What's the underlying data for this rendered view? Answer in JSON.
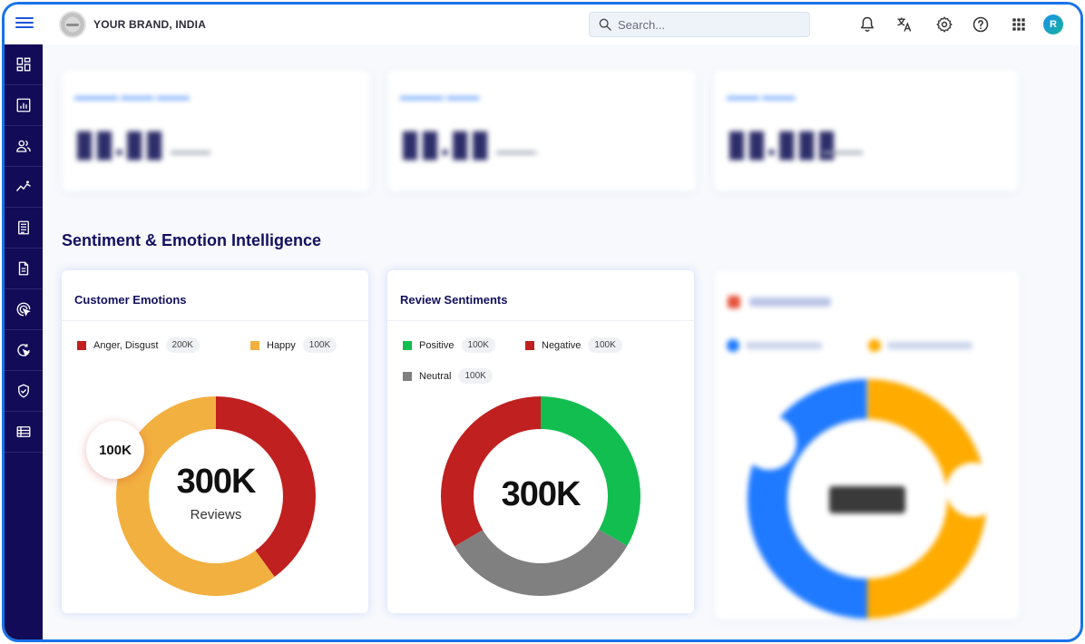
{
  "brand": {
    "name": "YOUR BRAND, INDIA"
  },
  "search": {
    "placeholder": "Search..."
  },
  "user": {
    "initial": "R"
  },
  "section": {
    "title": "Sentiment & Emotion Intelligence"
  },
  "customer_emotions": {
    "title": "Customer Emotions",
    "legend": [
      {
        "label": "Anger, Disgust",
        "count": "200K",
        "color": "#c0201f"
      },
      {
        "label": "Happy",
        "count": "100K",
        "color": "#f2b040"
      }
    ],
    "center_value": "300K",
    "center_label": "Reviews",
    "bubble_label": "100K",
    "segments": [
      {
        "label": "Anger, Disgust",
        "fraction": 0.4,
        "color": "#c0201f"
      },
      {
        "label": "Happy",
        "fraction": 0.6,
        "color": "#f2b040"
      }
    ]
  },
  "review_sentiments": {
    "title": "Review Sentiments",
    "legend": [
      {
        "label": "Positive",
        "count": "100K",
        "color": "#12be50"
      },
      {
        "label": "Negative",
        "count": "100K",
        "color": "#c0201f"
      },
      {
        "label": "Neutral",
        "count": "100K",
        "color": "#808080"
      }
    ],
    "center_value": "300K",
    "segments": [
      {
        "label": "Positive",
        "fraction": 0.333,
        "color": "#12be50"
      },
      {
        "label": "Neutral",
        "fraction": 0.333,
        "color": "#808080"
      },
      {
        "label": "Negative",
        "fraction": 0.334,
        "color": "#c0201f"
      }
    ]
  }
}
